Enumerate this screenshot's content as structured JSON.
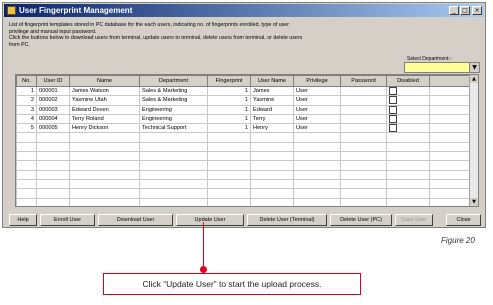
{
  "window": {
    "title": "User Fingerprint Management",
    "controls": {
      "minimize": "_",
      "maximize": "□",
      "close": "×"
    }
  },
  "description": [
    "List of fingerprint templates stored in PC database for the each users, indicating no. of fingerprints enrolled, type of user",
    "privilege and manual input password.",
    "Click the buttons below to download users from terminal, update users to terminal, delete users from terminal, or delete users",
    "from PC."
  ],
  "department": {
    "label": "Select Department:-",
    "value": ""
  },
  "table": {
    "columns": [
      "No.",
      "User ID",
      "Name",
      "Department",
      "Fingerprint",
      "User Name",
      "Privilege",
      "Password",
      "Disabled"
    ],
    "rows": [
      {
        "no": "1",
        "user_id": "000001",
        "name": "James Watson",
        "department": "Sales & Marketing",
        "fingerprint": "1",
        "user_name": "James",
        "privilege": "User",
        "password": "",
        "disabled": false
      },
      {
        "no": "2",
        "user_id": "000002",
        "name": "Yasmine Utah",
        "department": "Sales & Marketing",
        "fingerprint": "1",
        "user_name": "Yasmine",
        "privilege": "User",
        "password": "",
        "disabled": false
      },
      {
        "no": "3",
        "user_id": "000003",
        "name": "Edward Doven",
        "department": "Engineering",
        "fingerprint": "1",
        "user_name": "Edward",
        "privilege": "User",
        "password": "",
        "disabled": false
      },
      {
        "no": "4",
        "user_id": "000004",
        "name": "Terry Roland",
        "department": "Engineering",
        "fingerprint": "1",
        "user_name": "Terry",
        "privilege": "User",
        "password": "",
        "disabled": false
      },
      {
        "no": "5",
        "user_id": "000005",
        "name": "Henry Dickson",
        "department": "Technical Support",
        "fingerprint": "1",
        "user_name": "Henry",
        "privilege": "User",
        "password": "",
        "disabled": false
      }
    ],
    "empty_rows": 10
  },
  "buttons": {
    "help": "Help",
    "enroll": "Enroll User",
    "download": "Download User",
    "update": "Update User",
    "delete_terminal": "Delete User (Terminal)",
    "delete_pc": "Delete User (PC)",
    "save": "Save User",
    "close": "Close"
  },
  "figure_label": "Figure 20",
  "callout": "Click “Update User” to start the upload process.",
  "colors": {
    "title_bar": "#0a246a",
    "callout": "#e0001b",
    "dept_select_bg": "#ffff99"
  }
}
